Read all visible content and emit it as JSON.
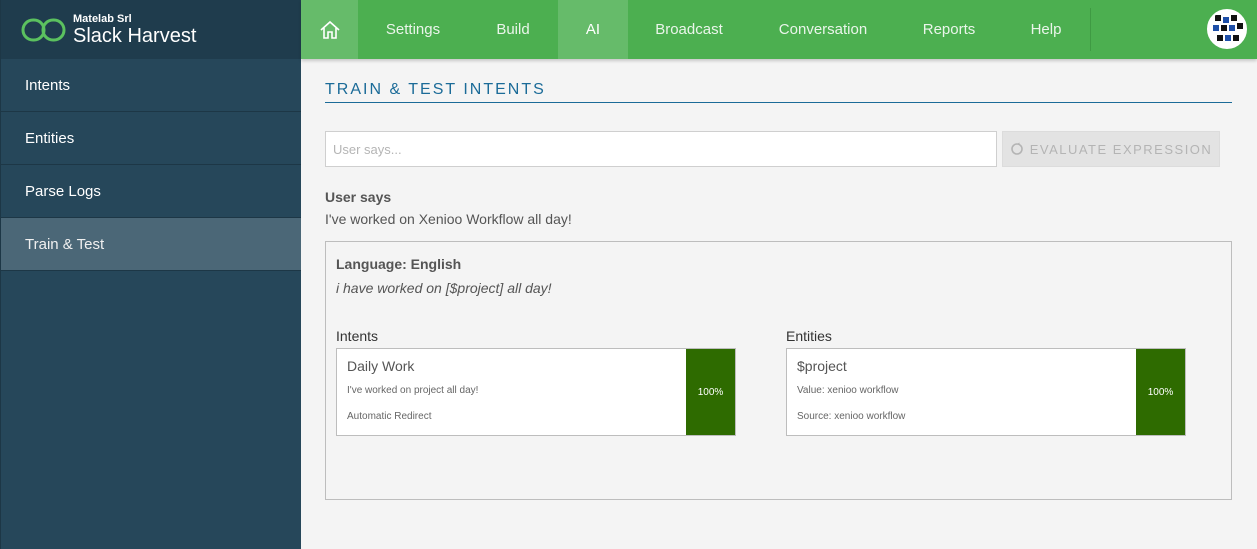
{
  "brand": {
    "company": "Matelab Srl",
    "name": "Slack Harvest",
    "accent": "#4caf50"
  },
  "sidebar": {
    "items": [
      {
        "label": "Intents"
      },
      {
        "label": "Entities"
      },
      {
        "label": "Parse Logs"
      },
      {
        "label": "Train & Test",
        "active": true
      }
    ]
  },
  "nav": {
    "home_icon": "home-icon",
    "items": [
      {
        "label": "Settings"
      },
      {
        "label": "Build"
      },
      {
        "label": "AI",
        "active": true
      },
      {
        "label": "Broadcast"
      },
      {
        "label": "Conversation"
      },
      {
        "label": "Reports"
      },
      {
        "label": "Help"
      }
    ]
  },
  "main": {
    "title": "TRAIN & TEST INTENTS",
    "input_placeholder": "User says...",
    "input_value": "",
    "evaluate_label": "EVALUATE EXPRESSION",
    "user_says_label": "User says",
    "user_says_text": "I've worked on Xenioo Workflow all day!",
    "result": {
      "language": "Language: English",
      "parsed": "i have worked on [$project] all day!",
      "intents_label": "Intents",
      "entities_label": "Entities",
      "intent": {
        "title": "Daily Work",
        "example": "I've worked on project all day!",
        "action": "Automatic Redirect",
        "score": "100%"
      },
      "entity": {
        "title": "$project",
        "value": "Value: xenioo workflow",
        "source": "Source: xenioo workflow",
        "score": "100%"
      },
      "score_color": "#2e6b00"
    }
  }
}
